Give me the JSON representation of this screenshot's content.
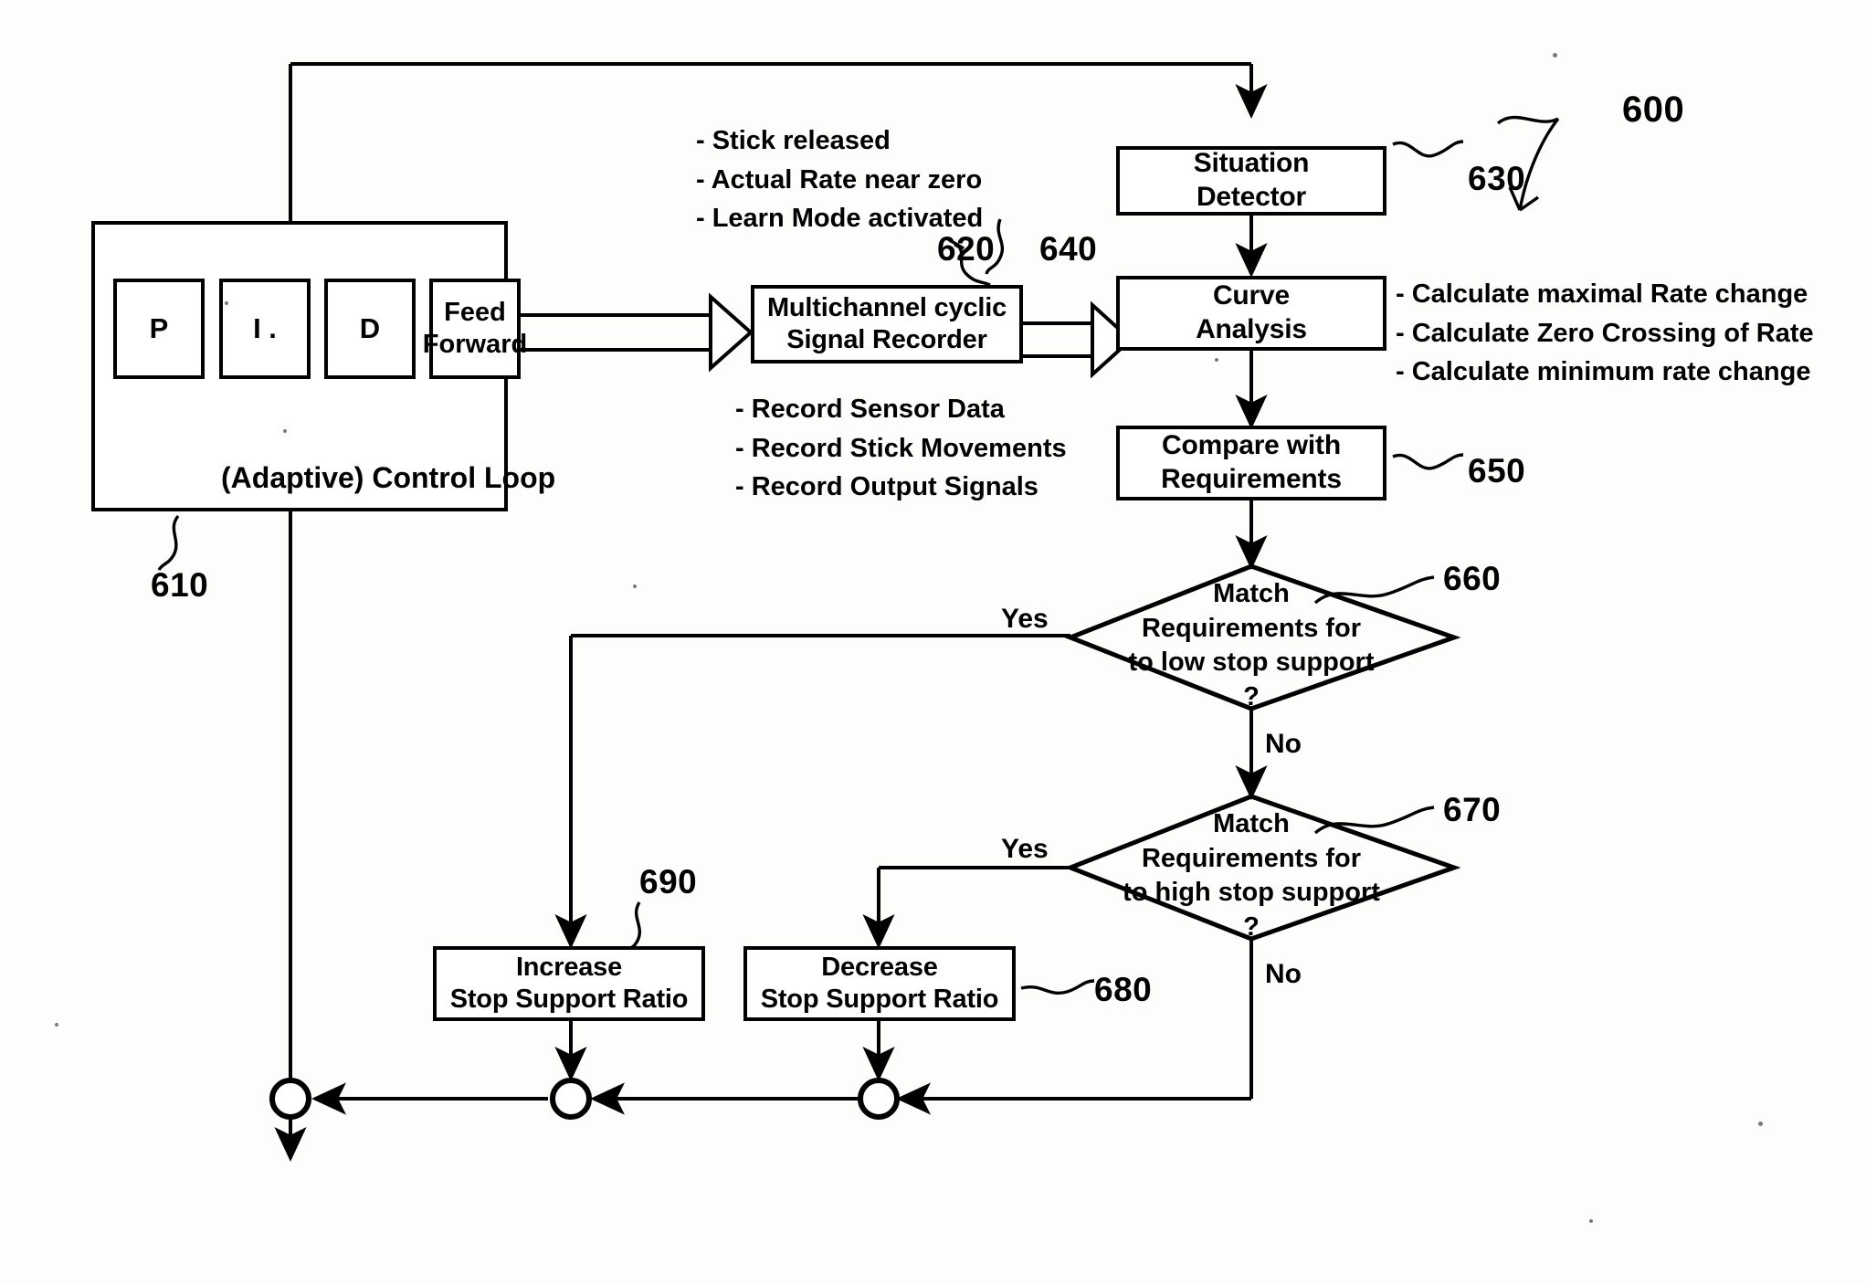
{
  "figure": {
    "ref_main": "600",
    "type": "patent-flow-diagram"
  },
  "control_loop": {
    "ref": "610",
    "title": "(Adaptive) Control Loop",
    "cells": [
      {
        "label": "P"
      },
      {
        "label": "I ."
      },
      {
        "label": "D"
      },
      {
        "label": "Feed\nForward"
      }
    ]
  },
  "recorder": {
    "ref": "620",
    "title_line1": "Multichannel cyclic",
    "title_line2": "Signal Recorder",
    "notes": [
      "- Record Sensor Data",
      "- Record Stick Movements",
      "- Record Output Signals"
    ]
  },
  "situation_detector": {
    "ref": "630",
    "title_line1": "Situation",
    "title_line2": "Detector",
    "conditions": [
      "- Stick released",
      "- Actual Rate near zero",
      "- Learn Mode activated"
    ]
  },
  "curve_analysis": {
    "ref": "640",
    "title_line1": "Curve",
    "title_line2": "Analysis",
    "notes": [
      "- Calculate maximal Rate change",
      "- Calculate Zero Crossing of Rate",
      "- Calculate minimum rate change"
    ]
  },
  "compare": {
    "ref": "650",
    "title_line1": "Compare with",
    "title_line2": "Requirements"
  },
  "decision_low": {
    "ref": "660",
    "line1": "Match",
    "line2": "Requirements for",
    "line3": "to low stop support",
    "line4": "?",
    "yes_label": "Yes",
    "no_label": "No"
  },
  "decision_high": {
    "ref": "670",
    "line1": "Match",
    "line2": "Requirements for",
    "line3": "to high stop support",
    "line4": "?",
    "yes_label": "Yes",
    "no_label": "No"
  },
  "increase_action": {
    "ref": "690",
    "line1": "Increase",
    "line2": "Stop Support Ratio"
  },
  "decrease_action": {
    "ref": "680",
    "line1": "Decrease",
    "line2": "Stop Support Ratio"
  },
  "colors": {
    "ink": "#000000",
    "paper": "#fdfdfb"
  }
}
